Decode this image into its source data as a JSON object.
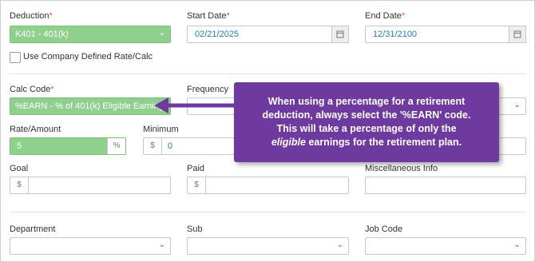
{
  "form": {
    "deduction": {
      "label": "Deduction",
      "required": "*",
      "value": "K401 - 401(k)"
    },
    "start_date": {
      "label": "Start Date",
      "required": "*",
      "value": "02/21/2025"
    },
    "end_date": {
      "label": "End Date",
      "required": "*",
      "value": "12/31/2100"
    },
    "use_company_rate": {
      "label": "Use Company Defined Rate/Calc",
      "checked": false
    },
    "calc_code": {
      "label": "Calc Code",
      "required": "*",
      "value": "%EARN - % of 401(k) Eligible Earnings"
    },
    "frequency": {
      "label": "Frequency",
      "value": ""
    },
    "rate_amount": {
      "label": "Rate/Amount",
      "value": "5",
      "suffix": "%"
    },
    "minimum": {
      "label": "Minimum",
      "prefix": "$",
      "value": "0"
    },
    "goal": {
      "label": "Goal",
      "prefix": "$",
      "value": ""
    },
    "paid": {
      "label": "Paid",
      "prefix": "$",
      "value": ""
    },
    "misc_info": {
      "label": "Miscellaneous Info",
      "value": ""
    },
    "department": {
      "label": "Department",
      "value": ""
    },
    "sub": {
      "label": "Sub",
      "value": ""
    },
    "job_code": {
      "label": "Job Code",
      "value": ""
    }
  },
  "callout": {
    "line1": "When using a percentage for a retirement",
    "line2": "deduction, always select the '%EARN' code.",
    "line3": "This will take a percentage of only the",
    "line4_em": "eligible",
    "line4_rest": " earnings for the retirement plan."
  },
  "colors": {
    "selected_green": "#8fd08f",
    "callout_purple": "#6f3aa0",
    "required_red": "#d9534f",
    "date_blue": "#2a7ab8"
  },
  "icons": {
    "dropdown": "chevron-down-icon",
    "date": "calendar-icon"
  }
}
